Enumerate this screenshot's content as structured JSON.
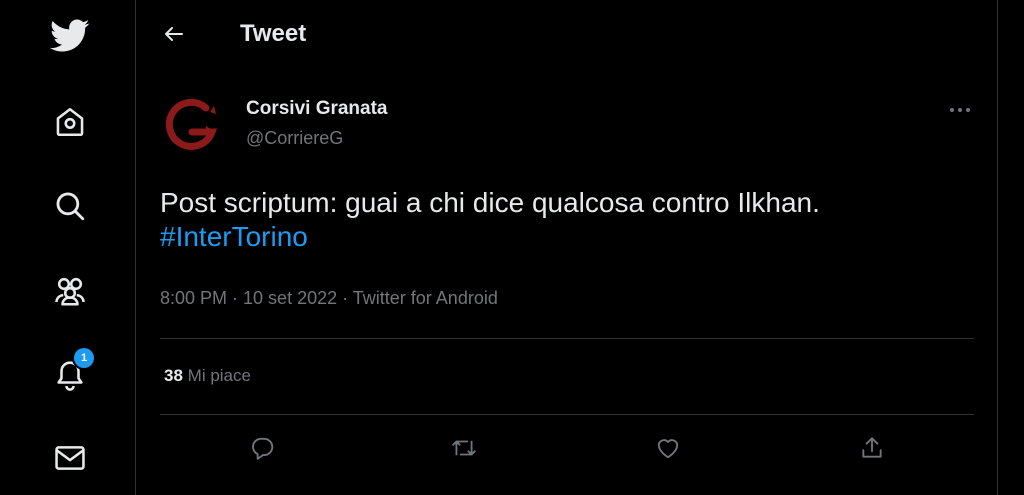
{
  "sidebar": {
    "items": [
      {
        "icon": "twitter-logo-icon"
      },
      {
        "icon": "home-icon"
      },
      {
        "icon": "search-icon"
      },
      {
        "icon": "communities-icon"
      },
      {
        "icon": "notifications-icon",
        "badge": "1"
      },
      {
        "icon": "messages-icon"
      }
    ]
  },
  "header": {
    "back_icon": "arrow-left-icon",
    "title": "Tweet"
  },
  "tweet": {
    "author": {
      "display_name": "Corsivi Granata",
      "handle": "@CorriereG"
    },
    "text": "Post scriptum: guai a chi dice qualcosa contro Ilkhan.",
    "hashtag": "#InterTorino",
    "meta": "8:00 PM · 10 set 2022 · Twitter for Android",
    "likes_count": "38",
    "likes_label": "Mi piace",
    "actions": [
      "reply-icon",
      "retweet-icon",
      "like-icon",
      "share-icon"
    ]
  },
  "colors": {
    "background": "#000000",
    "text": "#e7e9ea",
    "secondary_text": "#71767b",
    "accent": "#1d9bf0",
    "divider": "#2f3336",
    "avatar_logo": "#8b1a1a"
  }
}
